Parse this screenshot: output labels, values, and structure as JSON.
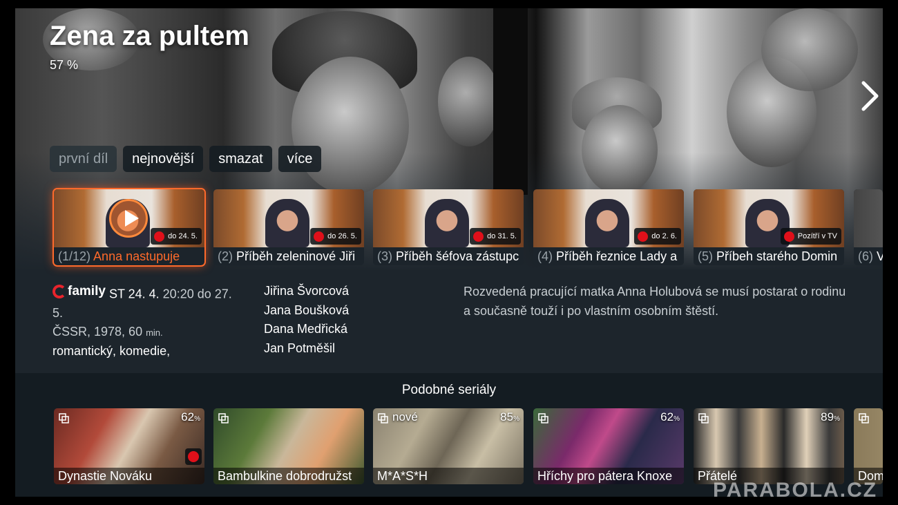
{
  "show": {
    "title": "Zena za pultem",
    "rating": "57 %"
  },
  "actions": [
    {
      "label": "první díl"
    },
    {
      "label": "nejnovější"
    },
    {
      "label": "smazat"
    },
    {
      "label": "více"
    }
  ],
  "episodes": [
    {
      "num": "(1/12)",
      "name": "Anna nastupuje",
      "availability": "do 24. 5."
    },
    {
      "num": "(2)",
      "name": "Příběh zeleninové Jiři",
      "availability": "do 26. 5."
    },
    {
      "num": "(3)",
      "name": "Příběh šéfova zástupc",
      "availability": "do 31. 5."
    },
    {
      "num": "(4)",
      "name": "Příběh řeznice Lady a",
      "availability": "do 2. 6."
    },
    {
      "num": "(5)",
      "name": "Příbeh starého Domin",
      "availability": "Pozítří v TV"
    },
    {
      "num": "(6)",
      "name": "V",
      "availability": ""
    }
  ],
  "info": {
    "channel": "family",
    "airing_day": "ST 24. 4.",
    "airing_time": "20:20 do 27. 5.",
    "origin": "ČSSR, 1978, 60",
    "duration_unit": "min.",
    "genre_1": "romantický",
    "genre_2": "komedie,"
  },
  "cast": [
    "Jiřina Švorcová",
    "Jana Boušková",
    "Dana Medřická",
    "Jan Potměšil"
  ],
  "description": "Rozvedená pracující matka Anna Holubová se musí postarat o rodinu a současně touží i po vlastním osobním štěstí.",
  "similar": {
    "title": "Podobné seriály",
    "items": [
      {
        "name": "Dynastie Nováku",
        "pct": "62",
        "pct_unit": "%",
        "tag": ""
      },
      {
        "name": "Bambulkine dobrodružst",
        "pct": "",
        "pct_unit": "",
        "tag": ""
      },
      {
        "name": "M*A*S*H",
        "pct": "85",
        "pct_unit": "%",
        "tag": "nové"
      },
      {
        "name": "Hříchy pro pátera Knoxe",
        "pct": "62",
        "pct_unit": "%",
        "tag": ""
      },
      {
        "name": "Přátelé",
        "pct": "89",
        "pct_unit": "%",
        "tag": ""
      },
      {
        "name": "Dom",
        "pct": "",
        "pct_unit": "",
        "tag": ""
      }
    ]
  },
  "watermark": "PARABOLA.CZ",
  "colors": {
    "accent": "#ff6a2b",
    "record": "#e0101a",
    "background": "#1d252c"
  },
  "icons": {
    "next": "chevron-right-icon",
    "play": "play-icon",
    "record": "record-dot-icon",
    "series": "copy-icon",
    "channel": "family-logo-icon"
  }
}
